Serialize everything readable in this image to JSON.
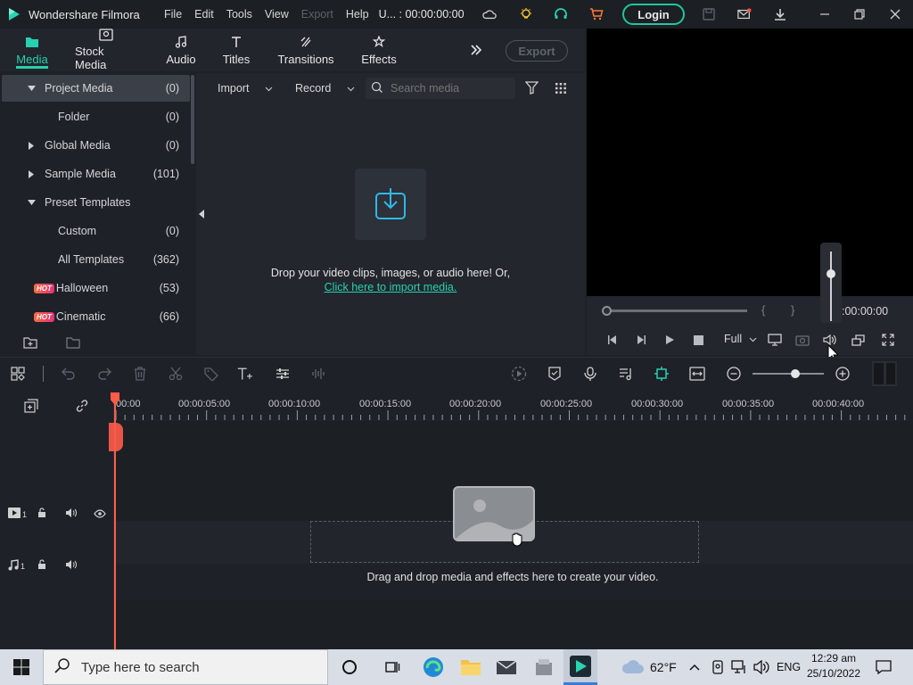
{
  "window": {
    "app_name": "Wondershare Filmora",
    "menu": [
      "File",
      "Edit",
      "Tools",
      "View",
      "Export",
      "Help"
    ],
    "project_time": "U... : 00:00:00:00",
    "login_label": "Login"
  },
  "tabs": [
    {
      "label": "Media",
      "icon": "folder-icon"
    },
    {
      "label": "Stock Media",
      "icon": "image-icon"
    },
    {
      "label": "Audio",
      "icon": "music-icon"
    },
    {
      "label": "Titles",
      "icon": "text-icon"
    },
    {
      "label": "Transitions",
      "icon": "transition-icon"
    },
    {
      "label": "Effects",
      "icon": "effects-icon"
    }
  ],
  "export_label": "Export",
  "sidebar": {
    "items": [
      {
        "label": "Project Media",
        "count": "(0)"
      },
      {
        "label": "Folder",
        "count": "(0)"
      },
      {
        "label": "Global Media",
        "count": "(0)"
      },
      {
        "label": "Sample Media",
        "count": "(101)"
      },
      {
        "label": "Preset Templates",
        "count": ""
      },
      {
        "label": "Custom",
        "count": "(0)"
      },
      {
        "label": "All Templates",
        "count": "(362)"
      },
      {
        "label": "Halloween",
        "count": "(53)"
      },
      {
        "label": "Cinematic",
        "count": "(66)"
      }
    ],
    "hot_badge": "HOT"
  },
  "media": {
    "import_label": "Import",
    "record_label": "Record",
    "search_placeholder": "Search media",
    "drop_text": "Drop your video clips, images, or audio here! Or,",
    "import_link": "Click here to import media."
  },
  "preview": {
    "timecode": ":00:00:00",
    "quality": "Full",
    "mark_in": "{",
    "mark_out": "}"
  },
  "timeline": {
    "ruler_labels": [
      "00:00",
      "00:00:05:00",
      "00:00:10:00",
      "00:00:15:00",
      "00:00:20:00",
      "00:00:25:00",
      "00:00:30:00",
      "00:00:35:00",
      "00:00:40:00"
    ],
    "video_track": "1",
    "audio_track": "1",
    "drop_hint": "Drag and drop media and effects here to create your video.",
    "zoom_level": 0.6
  },
  "taskbar": {
    "search_placeholder": "Type here to search",
    "weather": "62°F",
    "lang": "ENG",
    "time": "12:29 am",
    "date": "25/10/2022"
  },
  "colors": {
    "accent": "#26d0b0",
    "playhead": "#ff5b4a"
  }
}
